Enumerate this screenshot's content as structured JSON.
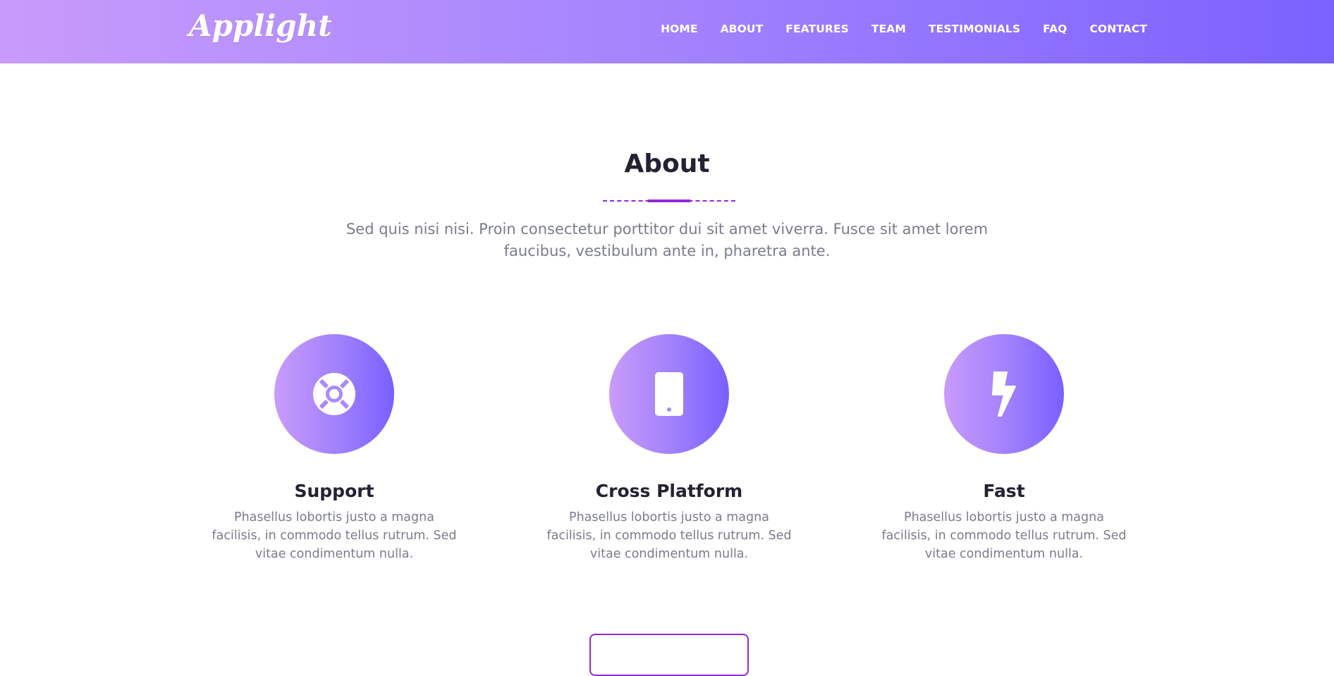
{
  "brand": {
    "logo_text": "Applight"
  },
  "nav": {
    "items": [
      "HOME",
      "ABOUT",
      "FEATURES",
      "TEAM",
      "TESTIMONIALS",
      "FAQ",
      "CONTACT"
    ]
  },
  "about": {
    "title": "About",
    "description": "Sed quis nisi nisi. Proin consectetur porttitor dui sit amet viverra. Fusce sit amet lorem faucibus, vestibulum ante in, pharetra ante.",
    "features": [
      {
        "icon": "lifebuoy-icon",
        "title": "Support",
        "text": "Phasellus lobortis justo a magna facilisis, in commodo tellus rutrum. Sed vitae condimentum nulla."
      },
      {
        "icon": "mobile-icon",
        "title": "Cross Platform",
        "text": "Phasellus lobortis justo a magna facilisis, in commodo tellus rutrum. Sed vitae condimentum nulla."
      },
      {
        "icon": "lightning-icon",
        "title": "Fast",
        "text": "Phasellus lobortis justo a magna facilisis, in commodo tellus rutrum. Sed vitae condimentum nulla."
      }
    ]
  },
  "colors": {
    "gradient_start": "#c89bfb",
    "gradient_end": "#7b61ff",
    "accent": "#9327d8",
    "heading": "#222233",
    "body_text": "#7a7d89"
  }
}
